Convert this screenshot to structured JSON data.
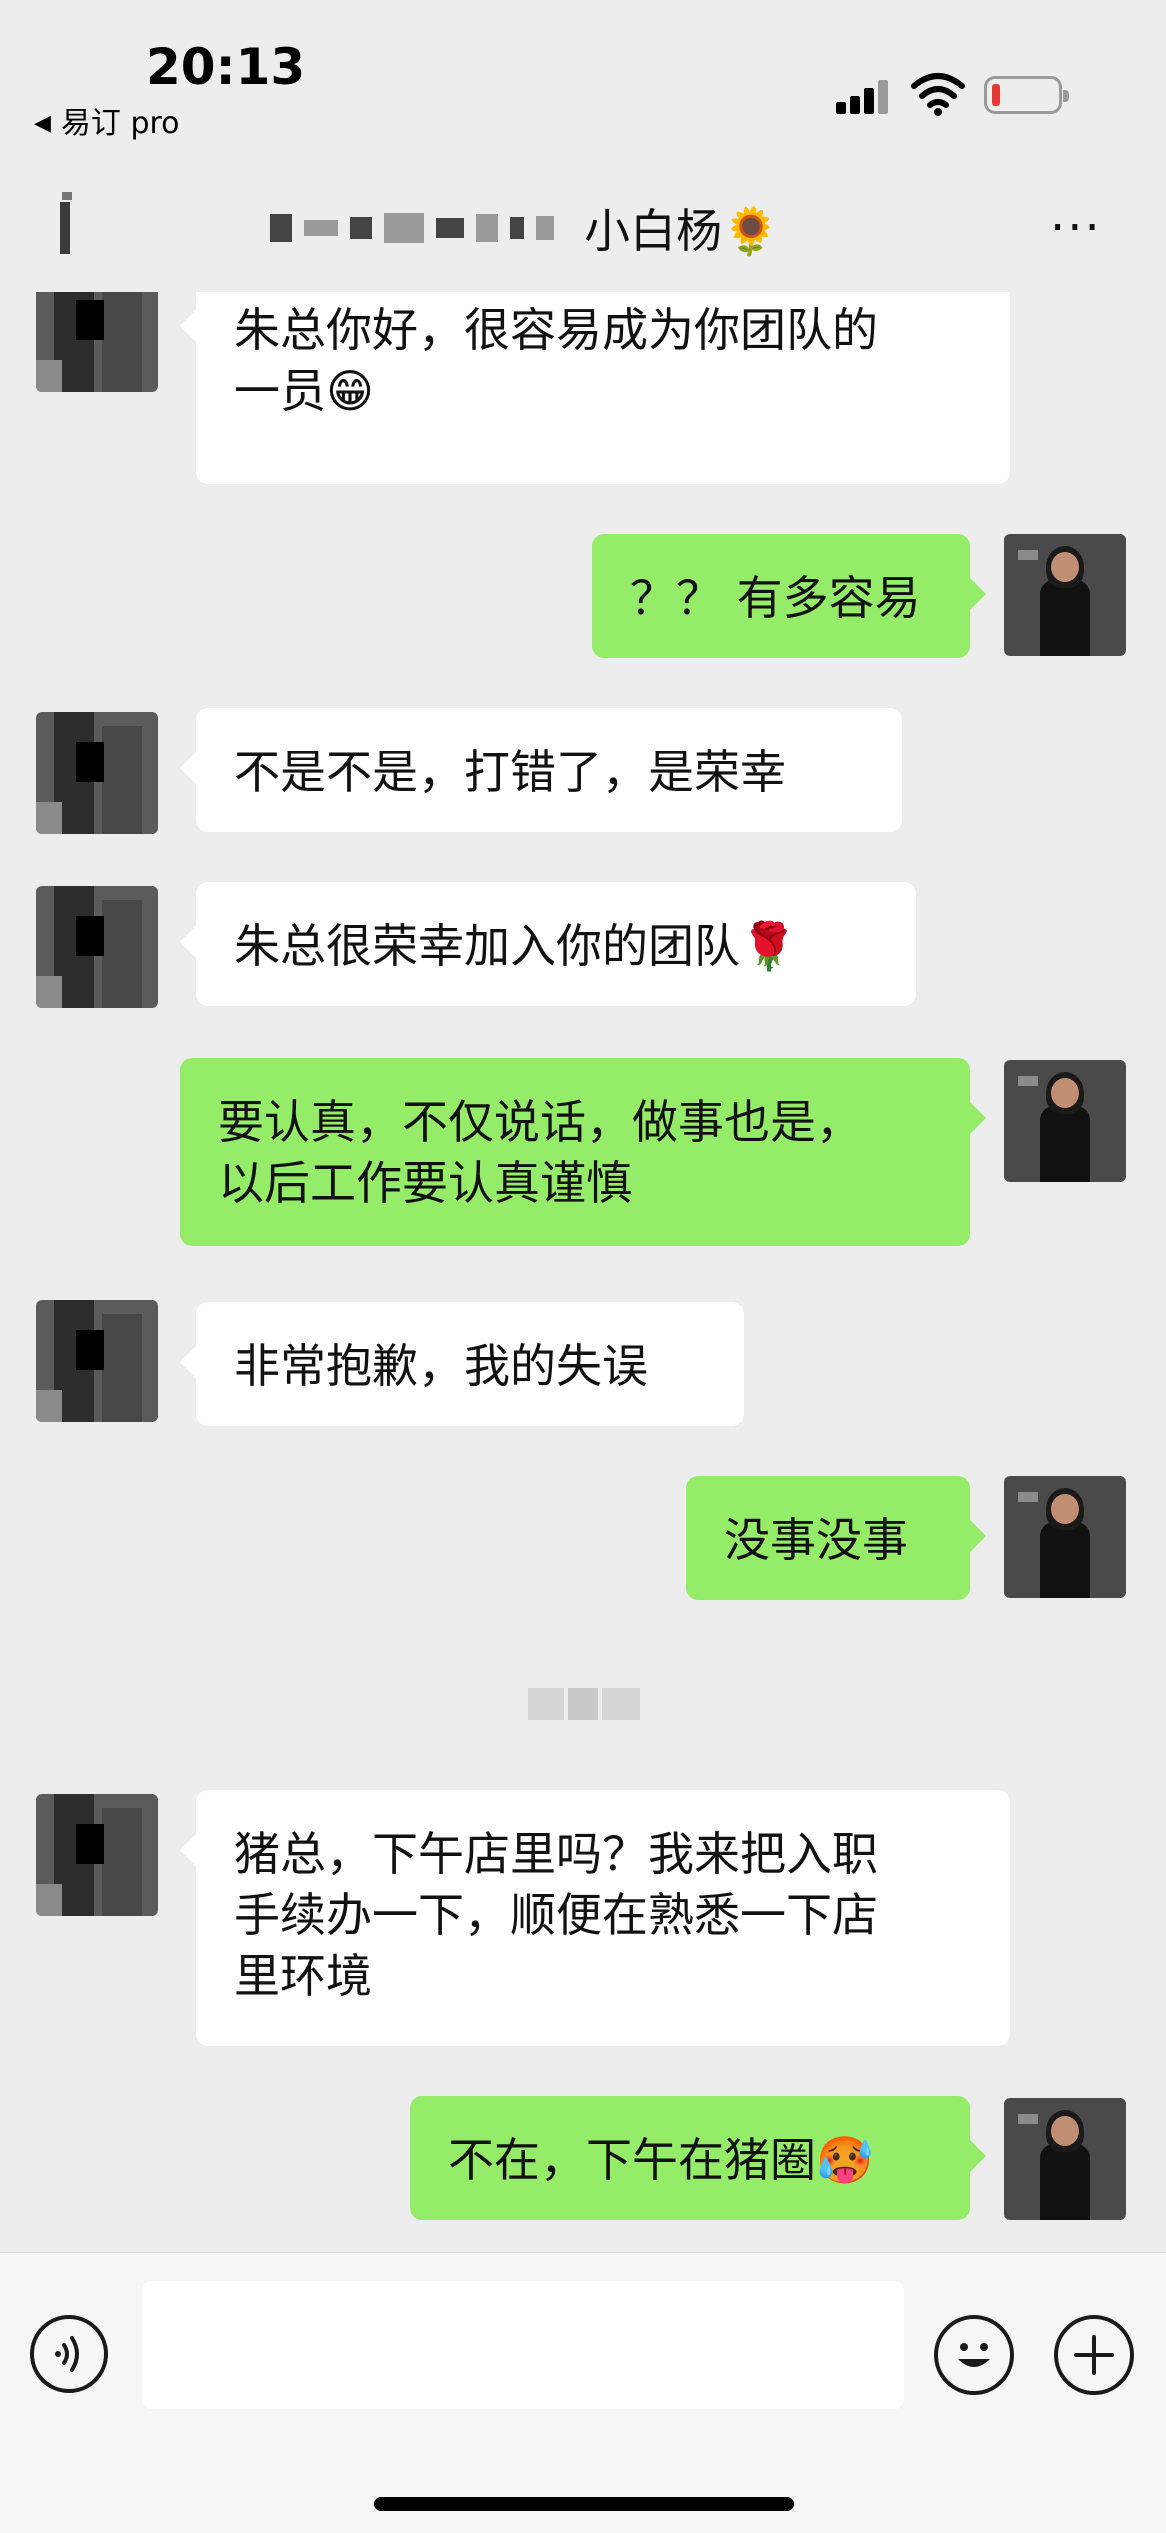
{
  "status_bar": {
    "time": "20:13",
    "back_app": "易订 pro",
    "back_arrow": "◀"
  },
  "nav": {
    "title": "小白杨🌻",
    "more": "···"
  },
  "messages": [
    {
      "side": "left",
      "text": "朱总你好，很容易成为你团队的\n一员😁"
    },
    {
      "side": "right",
      "text": "？？ 有多容易"
    },
    {
      "side": "left",
      "text": "不是不是，打错了，是荣幸"
    },
    {
      "side": "left",
      "text": "朱总很荣幸加入你的团队🌹"
    },
    {
      "side": "right",
      "text": "要认真，不仅说话，做事也是，\n以后工作要认真谨慎"
    },
    {
      "side": "left",
      "text": "非常抱歉，我的失误"
    },
    {
      "side": "right",
      "text": "没事没事"
    },
    {
      "side": "left",
      "text": "猪总，下午店里吗？我来把入职\n手续办一下，顺便在熟悉一下店\n里环境"
    },
    {
      "side": "right",
      "text": "不在，下午在猪圈🥵"
    }
  ],
  "icons": {
    "voice": "voice-icon",
    "emoji": "emoji-icon",
    "plus": "plus-icon"
  }
}
